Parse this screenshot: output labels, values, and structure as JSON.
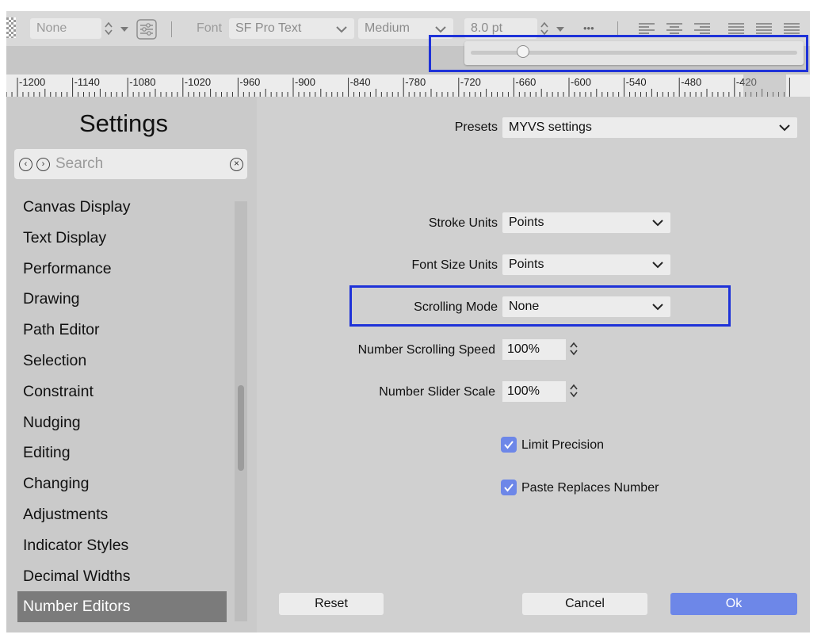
{
  "toolbar": {
    "style_value": "None",
    "font_label": "Font",
    "font_family": "SF Pro Text",
    "font_weight": "Medium",
    "font_size": "8.0 pt",
    "more_glyph": "•••"
  },
  "ruler": {
    "labels": [
      "-1200",
      "-1140",
      "-1080",
      "-1020",
      "-960",
      "-900",
      "-840",
      "-780",
      "-720",
      "-660",
      "-600",
      "-540",
      "-480",
      "-420"
    ]
  },
  "sidebar": {
    "title": "Settings",
    "search_placeholder": "Search",
    "items": [
      {
        "label": "Canvas Display"
      },
      {
        "label": "Text Display"
      },
      {
        "label": "Performance"
      },
      {
        "label": "Drawing"
      },
      {
        "label": "Path Editor"
      },
      {
        "label": "Selection"
      },
      {
        "label": "Constraint"
      },
      {
        "label": "Nudging"
      },
      {
        "label": "Editing"
      },
      {
        "label": "Changing"
      },
      {
        "label": "Adjustments"
      },
      {
        "label": "Indicator Styles"
      },
      {
        "label": "Decimal Widths"
      },
      {
        "label": "Number Editors",
        "selected": true
      }
    ]
  },
  "main": {
    "presets_label": "Presets",
    "presets_value": "MYVS settings",
    "stroke_units_label": "Stroke Units",
    "stroke_units_value": "Points",
    "font_size_units_label": "Font Size Units",
    "font_size_units_value": "Points",
    "scrolling_mode_label": "Scrolling Mode",
    "scrolling_mode_value": "None",
    "scroll_speed_label": "Number Scrolling Speed",
    "scroll_speed_value": "100%",
    "slider_scale_label": "Number Slider Scale",
    "slider_scale_value": "100%",
    "limit_precision_label": "Limit Precision",
    "paste_replaces_label": "Paste Replaces Number"
  },
  "buttons": {
    "reset": "Reset",
    "cancel": "Cancel",
    "ok": "Ok"
  },
  "colors": {
    "accent": "#6d87e8",
    "highlight_box": "#1e32d8",
    "selected_item": "#7b7b7b"
  }
}
